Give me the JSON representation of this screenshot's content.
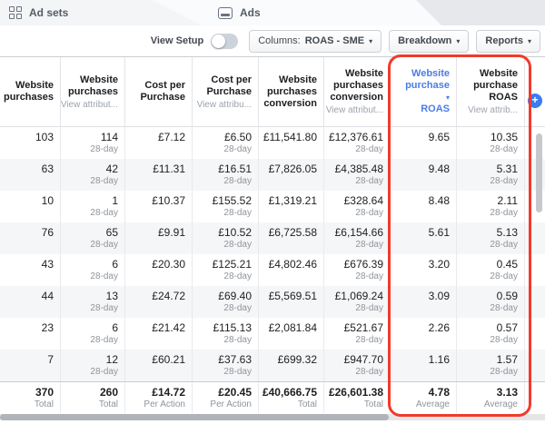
{
  "tabs": [
    {
      "label": "Ad sets",
      "icon": "ad-sets-grid-icon"
    },
    {
      "label": "Ads",
      "icon": "ads-board-icon"
    }
  ],
  "toolbar": {
    "view_setup_label": "View Setup",
    "view_setup_state": "off",
    "columns_prefix": "Columns:",
    "columns_value": "ROAS - SME",
    "breakdown_label": "Breakdown",
    "reports_label": "Reports"
  },
  "table": {
    "columns": [
      {
        "title": "Website purchases",
        "sub": ""
      },
      {
        "title": "Website purchases",
        "sub": "View attribut..."
      },
      {
        "title": "Cost per Purchase",
        "sub": ""
      },
      {
        "title": "Cost per Purchase",
        "sub": "View attribu..."
      },
      {
        "title": "Website purchases conversion",
        "sub": ""
      },
      {
        "title": "Website purchases conversion",
        "sub": "View attribut..."
      },
      {
        "title": "Website purchase ROAS",
        "sub": "",
        "sorted": true,
        "caret_after_word": 1
      },
      {
        "title": "Website purchase ROAS",
        "sub": "View attrib..."
      }
    ],
    "rows": [
      [
        {
          "v": "103"
        },
        {
          "v": "114",
          "sub": "28-day"
        },
        {
          "v": "£7.12"
        },
        {
          "v": "£6.50",
          "sub": "28-day"
        },
        {
          "v": "£11,541.80"
        },
        {
          "v": "£12,376.61",
          "sub": "28-day"
        },
        {
          "v": "9.65"
        },
        {
          "v": "10.35",
          "sub": "28-day"
        }
      ],
      [
        {
          "v": "63"
        },
        {
          "v": "42",
          "sub": "28-day"
        },
        {
          "v": "£11.31"
        },
        {
          "v": "£16.51",
          "sub": "28-day"
        },
        {
          "v": "£7,826.05"
        },
        {
          "v": "£4,385.48",
          "sub": "28-day"
        },
        {
          "v": "9.48"
        },
        {
          "v": "5.31",
          "sub": "28-day"
        }
      ],
      [
        {
          "v": "10"
        },
        {
          "v": "1",
          "sub": "28-day"
        },
        {
          "v": "£10.37"
        },
        {
          "v": "£155.52",
          "sub": "28-day"
        },
        {
          "v": "£1,319.21"
        },
        {
          "v": "£328.64",
          "sub": "28-day"
        },
        {
          "v": "8.48"
        },
        {
          "v": "2.11",
          "sub": "28-day"
        }
      ],
      [
        {
          "v": "76"
        },
        {
          "v": "65",
          "sub": "28-day"
        },
        {
          "v": "£9.91"
        },
        {
          "v": "£10.52",
          "sub": "28-day"
        },
        {
          "v": "£6,725.58"
        },
        {
          "v": "£6,154.66",
          "sub": "28-day"
        },
        {
          "v": "5.61"
        },
        {
          "v": "5.13",
          "sub": "28-day"
        }
      ],
      [
        {
          "v": "43"
        },
        {
          "v": "6",
          "sub": "28-day"
        },
        {
          "v": "£20.30"
        },
        {
          "v": "£125.21",
          "sub": "28-day"
        },
        {
          "v": "£4,802.46"
        },
        {
          "v": "£676.39",
          "sub": "28-day"
        },
        {
          "v": "3.20"
        },
        {
          "v": "0.45",
          "sub": "28-day"
        }
      ],
      [
        {
          "v": "44"
        },
        {
          "v": "13",
          "sub": "28-day"
        },
        {
          "v": "£24.72"
        },
        {
          "v": "£69.40",
          "sub": "28-day"
        },
        {
          "v": "£5,569.51"
        },
        {
          "v": "£1,069.24",
          "sub": "28-day"
        },
        {
          "v": "3.09"
        },
        {
          "v": "0.59",
          "sub": "28-day"
        }
      ],
      [
        {
          "v": "23"
        },
        {
          "v": "6",
          "sub": "28-day"
        },
        {
          "v": "£21.42"
        },
        {
          "v": "£115.13",
          "sub": "28-day"
        },
        {
          "v": "£2,081.84"
        },
        {
          "v": "£521.67",
          "sub": "28-day"
        },
        {
          "v": "2.26"
        },
        {
          "v": "0.57",
          "sub": "28-day"
        }
      ],
      [
        {
          "v": "7"
        },
        {
          "v": "12",
          "sub": "28-day"
        },
        {
          "v": "£60.21"
        },
        {
          "v": "£37.63",
          "sub": "28-day"
        },
        {
          "v": "£699.32"
        },
        {
          "v": "£947.70",
          "sub": "28-day"
        },
        {
          "v": "1.16"
        },
        {
          "v": "1.57",
          "sub": "28-day"
        }
      ]
    ],
    "totals": [
      {
        "v": "370",
        "sub": "Total"
      },
      {
        "v": "260",
        "sub": "Total"
      },
      {
        "v": "£14.72",
        "sub": "Per Action"
      },
      {
        "v": "£20.45",
        "sub": "Per Action"
      },
      {
        "v": "£40,666.75",
        "sub": "Total"
      },
      {
        "v": "£26,601.38",
        "sub": "Total"
      },
      {
        "v": "4.78",
        "sub": "Average"
      },
      {
        "v": "3.13",
        "sub": "Average"
      }
    ]
  },
  "icons": {
    "plus": "+",
    "sort_caret": "▾",
    "dropdown_caret": "▾"
  },
  "colors": {
    "sorted_header_blue": "#4b7ce5",
    "plus_button_blue": "#3b7cf0",
    "annotation_red": "#f13a2c",
    "row_stripe": "#f5f6f7"
  },
  "annotation": {
    "type": "red-highlight-box",
    "highlights": "Website purchase ROAS columns"
  }
}
